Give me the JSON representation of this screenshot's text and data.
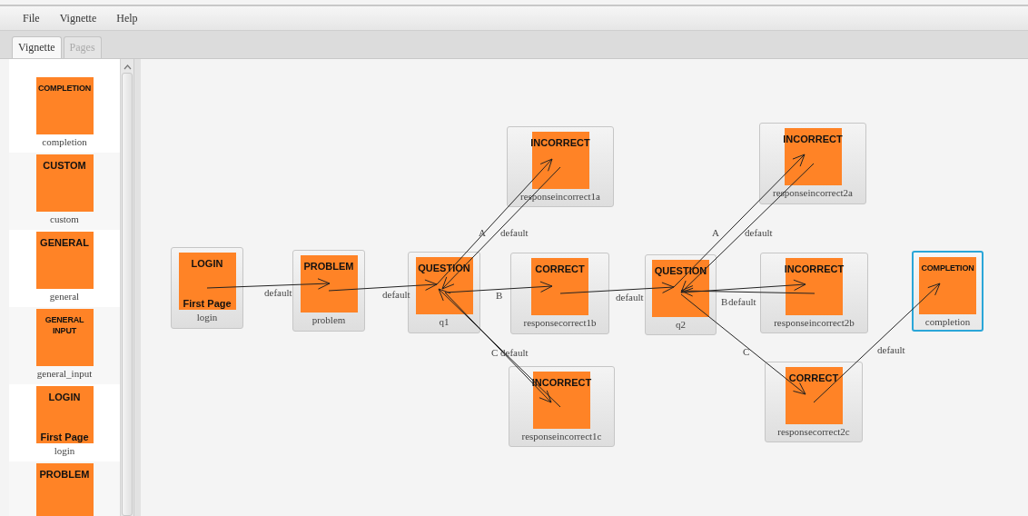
{
  "menu": [
    {
      "label": "File"
    },
    {
      "label": "Vignette"
    },
    {
      "label": "Help"
    }
  ],
  "tabs": [
    {
      "label": "Vignette",
      "selected": true
    },
    {
      "label": "Pages",
      "selected": false
    }
  ],
  "palette": [
    {
      "type": "COMPLETION",
      "name": "completion"
    },
    {
      "type": "CUSTOM",
      "name": "custom"
    },
    {
      "type": "GENERAL",
      "name": "general"
    },
    {
      "type": "GENERAL INPUT",
      "name": "general_input"
    },
    {
      "type": "LOGIN",
      "subtitle": "First Page",
      "name": "login"
    },
    {
      "type": "PROBLEM"
    }
  ],
  "nodes": [
    {
      "type": "LOGIN",
      "subtitle": "First Page",
      "name": "login",
      "selected": false
    },
    {
      "type": "PROBLEM",
      "name": "problem",
      "selected": false
    },
    {
      "type": "QUESTION",
      "name": "q1",
      "selected": false
    },
    {
      "type": "INCORRECT",
      "name": "responseincorrect1a",
      "selected": false
    },
    {
      "type": "CORRECT",
      "name": "responsecorrect1b",
      "selected": false
    },
    {
      "type": "INCORRECT",
      "name": "responseincorrect1c",
      "selected": false
    },
    {
      "type": "QUESTION",
      "name": "q2",
      "selected": false
    },
    {
      "type": "INCORRECT",
      "name": "responseincorrect2a",
      "selected": false
    },
    {
      "type": "INCORRECT",
      "name": "responseincorrect2b",
      "selected": false
    },
    {
      "type": "CORRECT",
      "name": "responsecorrect2c",
      "selected": false
    },
    {
      "type": "COMPLETION",
      "name": "completion",
      "selected": true
    }
  ],
  "edges": [
    {
      "label": "default"
    },
    {
      "label": "default"
    },
    {
      "label": "A"
    },
    {
      "label": "default"
    },
    {
      "label": "B"
    },
    {
      "label": "C"
    },
    {
      "label": "default"
    },
    {
      "label": "default"
    },
    {
      "label": "A"
    },
    {
      "label": "default"
    },
    {
      "label": "B"
    },
    {
      "label": "default"
    },
    {
      "label": "C"
    },
    {
      "label": "default"
    }
  ]
}
